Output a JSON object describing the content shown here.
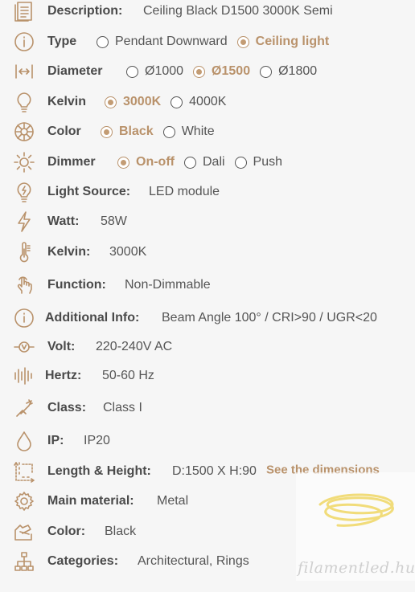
{
  "accent_color": "#b9926b",
  "rows": {
    "description": {
      "label": "Description:",
      "value": "Ceiling Black D1500 3000K Semi"
    },
    "type": {
      "label": "Type",
      "options": [
        {
          "label": "Pendant Downward",
          "selected": false
        },
        {
          "label": "Ceiling light",
          "selected": true
        }
      ]
    },
    "diameter": {
      "label": "Diameter",
      "options": [
        {
          "label": "Ø1000",
          "selected": false
        },
        {
          "label": "Ø1500",
          "selected": true
        },
        {
          "label": "Ø1800",
          "selected": false
        }
      ]
    },
    "kelvin_choice": {
      "label": "Kelvin",
      "options": [
        {
          "label": "3000K",
          "selected": true
        },
        {
          "label": "4000K",
          "selected": false
        }
      ]
    },
    "color_choice": {
      "label": "Color",
      "options": [
        {
          "label": "Black",
          "selected": true
        },
        {
          "label": "White",
          "selected": false
        }
      ]
    },
    "dimmer": {
      "label": "Dimmer",
      "options": [
        {
          "label": "On-off",
          "selected": true
        },
        {
          "label": "Dali",
          "selected": false
        },
        {
          "label": "Push",
          "selected": false
        }
      ]
    },
    "light_source": {
      "label": "Light Source:",
      "value": "LED module"
    },
    "watt": {
      "label": "Watt:",
      "value": "58W"
    },
    "kelvin": {
      "label": "Kelvin:",
      "value": "3000K"
    },
    "function": {
      "label": "Function:",
      "value": "Non-Dimmable"
    },
    "additional_info": {
      "label": "Additional Info:",
      "value": "Beam Angle 100°  /  CRI>90  /  UGR<20"
    },
    "volt": {
      "label": "Volt:",
      "value": "220-240V AC"
    },
    "hertz": {
      "label": "Hertz:",
      "value": "50-60 Hz"
    },
    "class": {
      "label": "Class:",
      "value": "Class I"
    },
    "ip": {
      "label": "IP:",
      "value": "IP20"
    },
    "length_height": {
      "label": "Length & Height:",
      "value": "D:1500 X H:90",
      "link": "See the dimensions"
    },
    "main_material": {
      "label": "Main material:",
      "value": "Metal"
    },
    "color": {
      "label": "Color:",
      "value": "Black"
    },
    "categories": {
      "label": "Categories:",
      "value": "Architectural, Rings"
    }
  },
  "watermark": {
    "text": "filamentled.hu"
  },
  "icons": [
    "document-icon",
    "info-icon",
    "diameter-icon",
    "bulb-icon",
    "color-wheel-icon",
    "sun-icon",
    "bulb-power-icon",
    "lightning-icon",
    "thermometer-icon",
    "touch-icon",
    "info-icon",
    "volt-icon",
    "hertz-icon",
    "class-icon",
    "drop-icon",
    "dimensions-icon",
    "gear-icon",
    "palette-icon",
    "sitemap-icon"
  ]
}
